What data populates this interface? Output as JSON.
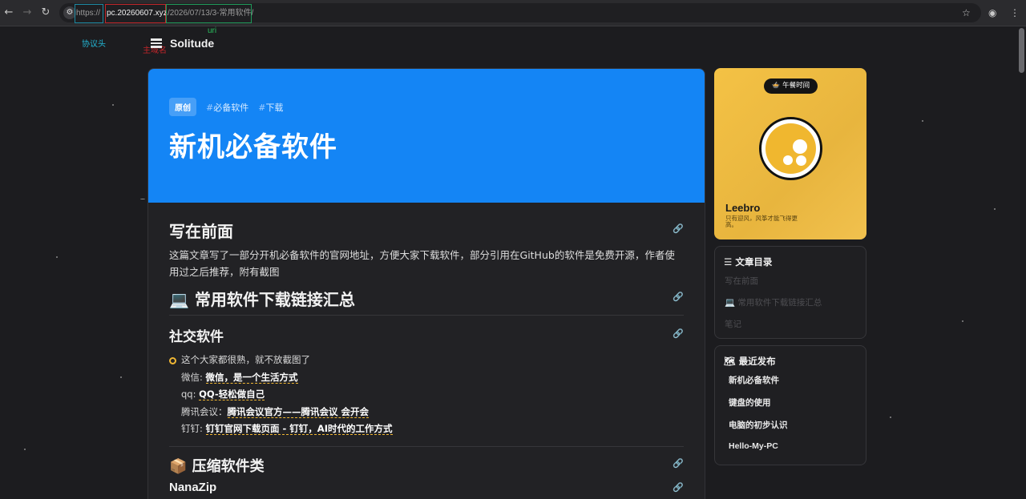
{
  "browser": {
    "url_scheme": "https://",
    "url_host": "pc.20260607.xyz",
    "url_path": "/2026/07/13/3-常用软件/"
  },
  "annotations": {
    "scheme_label": "协议头",
    "host_label": "主域名",
    "uri_label": "uri"
  },
  "site": {
    "name": "Solitude"
  },
  "article": {
    "badge": "原创",
    "tags": [
      "必备软件",
      "下载"
    ],
    "title": "新机必备软件",
    "section1_title": "写在前面",
    "section1_text": "这篇文章写了一部分开机必备软件的官网地址，方便大家下载软件，部分引用在GitHub的软件是免费开源，作者使用过之后推荐，附有截图",
    "section2_title": "💻 常用软件下载链接汇总",
    "social_title": "社交软件",
    "social_intro": "这个大家都很熟，就不放截图了",
    "social_items": [
      {
        "label": "微信: ",
        "link": "微信，是一个生活方式"
      },
      {
        "label": "qq: ",
        "link": "QQ-轻松做自己"
      },
      {
        "label": "腾讯会议：",
        "link": "腾讯会议官方——腾讯会议 会开会"
      },
      {
        "label": "钉钉: ",
        "link": "钉钉官网下载页面 - 钉钉，AI时代的工作方式"
      }
    ],
    "compress_title": "📦 压缩软件类",
    "nanozip_title": "NanaZip"
  },
  "profile": {
    "badge": "🍲 午餐时间",
    "name": "Leebro",
    "motto": "只有迎风，风筝才能飞得更高。"
  },
  "toc": {
    "title": "☰ 文章目录",
    "items": [
      "写在前面",
      "💻 常用软件下载链接汇总",
      "笔记"
    ]
  },
  "recent": {
    "title": "🗺 最近发布",
    "items": [
      "新机必备软件",
      "键盘的使用",
      "电脑的初步认识",
      "Hello-My-PC"
    ]
  }
}
